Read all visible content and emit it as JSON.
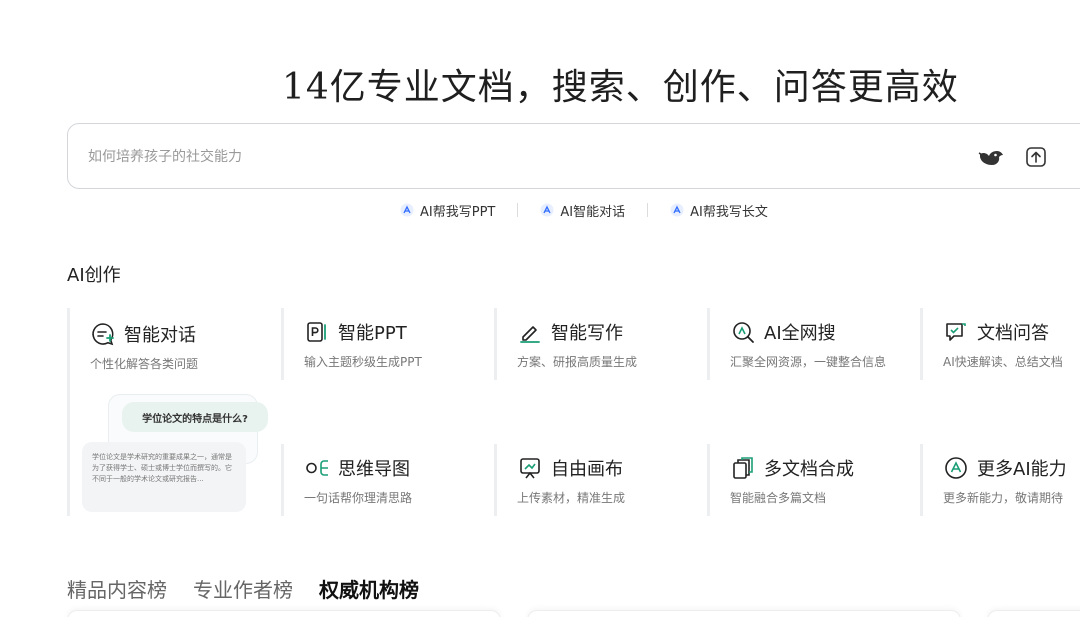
{
  "headline": "14亿专业文档，搜索、创作、问答更高效",
  "search": {
    "placeholder": "如何培养孩子的社交能力",
    "value": ""
  },
  "quick_links": [
    {
      "label": "AI帮我写PPT"
    },
    {
      "label": "AI智能对话"
    },
    {
      "label": "AI帮我写长文"
    }
  ],
  "ai_section_title": "AI创作",
  "hero_card": {
    "title": "智能对话",
    "desc": "个性化解答各类问题",
    "icon": "chat-plus-icon",
    "illustration": {
      "question": "学位论文的特点是什么?",
      "answer": "学位论文是学术研究的重要成果之一，通常是为了获得学士、硕士或博士学位而撰写的。它不同于一般的学术论文或研究报告..."
    }
  },
  "cards": [
    {
      "title": "智能PPT",
      "desc": "输入主题秒级生成PPT",
      "icon": "ppt-icon"
    },
    {
      "title": "智能写作",
      "desc": "方案、研报高质量生成",
      "icon": "pen-icon"
    },
    {
      "title": "AI全网搜",
      "desc": "汇聚全网资源，一键整合信息",
      "icon": "search-ai-icon"
    },
    {
      "title": "文档问答",
      "desc": "AI快速解读、总结文档",
      "icon": "doc-qa-icon"
    },
    {
      "title": "思维导图",
      "desc": "一句话帮你理清思路",
      "icon": "mindmap-icon"
    },
    {
      "title": "自由画布",
      "desc": "上传素材，精准生成",
      "icon": "canvas-icon"
    },
    {
      "title": "多文档合成",
      "desc": "智能融合多篇文档",
      "icon": "multi-doc-icon"
    },
    {
      "title": "更多AI能力",
      "desc": "更多新能力，敬请期待",
      "icon": "more-ai-icon"
    }
  ],
  "rank_tabs": [
    {
      "label": "精品内容榜",
      "active": false
    },
    {
      "label": "专业作者榜",
      "active": false
    },
    {
      "label": "权威机构榜",
      "active": true
    }
  ],
  "colors": {
    "accent": "#1a9e76",
    "ai_blue": "#2f6bff",
    "text": "#222222",
    "muted": "#777777"
  }
}
